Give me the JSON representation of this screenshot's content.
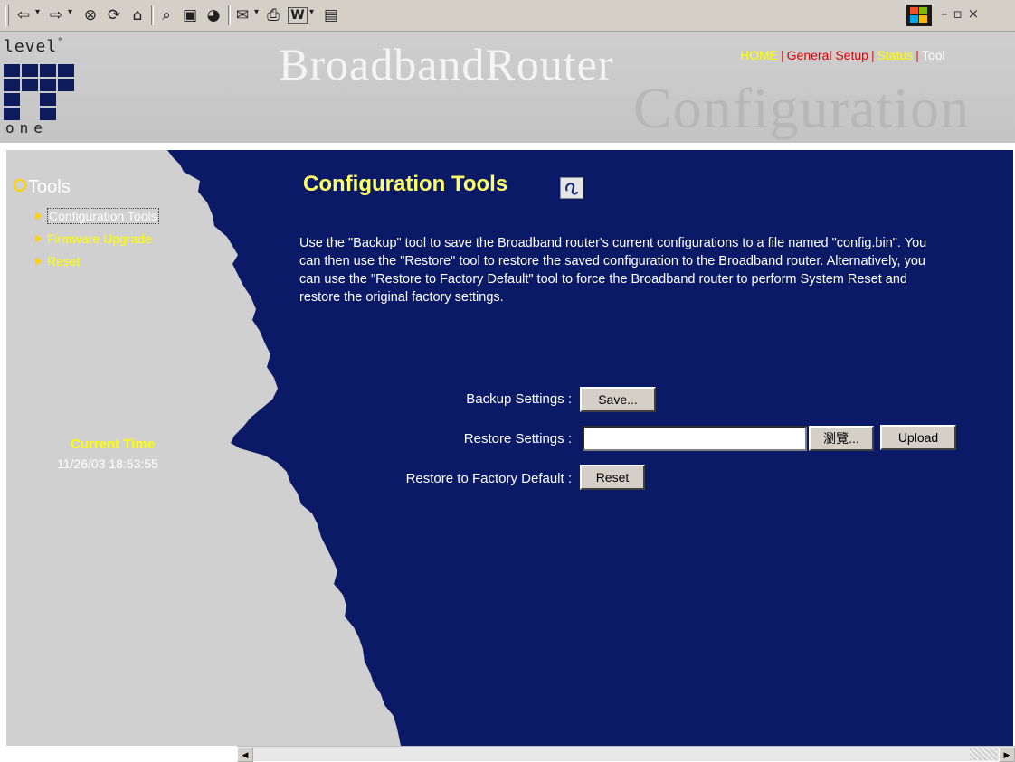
{
  "browser": {
    "toolbar_icons": [
      "back-arrow-icon",
      "forward-arrow-icon",
      "stop-icon",
      "refresh-icon",
      "home-icon",
      "search-icon",
      "favorites-icon",
      "history-icon",
      "mail-icon",
      "print-icon",
      "edit-word-icon",
      "discuss-icon"
    ],
    "back_glyph": "⇦",
    "forward_glyph": "⇨",
    "stop_glyph": "⊗",
    "refresh_glyph": "⟳",
    "home_glyph": "⌂",
    "search_glyph": "⌕",
    "favorites_glyph": "▣",
    "history_glyph": "◕",
    "mail_glyph": "✉",
    "print_glyph": "⎙",
    "edit_glyph": "W",
    "discuss_glyph": "▤",
    "dropdown_glyph": "▾",
    "window_controls": "–▫×"
  },
  "header": {
    "logo_top": "level",
    "logo_bottom": "one",
    "brand": "BroadbandRouter",
    "subtitle": "Configuration",
    "nav": {
      "home": "HOME",
      "general_setup": "General Setup",
      "status": "Status",
      "tool": "Tool"
    }
  },
  "sidebar": {
    "section_title": "Tools",
    "items": [
      {
        "label": "Configuration Tools",
        "active": true
      },
      {
        "label": "Firmware Upgrade",
        "active": false
      },
      {
        "label": "Reset",
        "active": false
      }
    ],
    "time_label": "Current Time",
    "time_value": "11/26/03 18:53:55"
  },
  "main": {
    "title": "Configuration Tools",
    "description": "Use the \"Backup\" tool to save the Broadband router's current configurations to a file named \"config.bin\". You can then use the \"Restore\" tool to restore the saved configuration to the Broadband router. Alternatively, you can use the \"Restore to Factory Default\" tool to force the Broadband router to perform System Reset and restore the original factory settings.",
    "backup_label": "Backup Settings :",
    "backup_button": "Save...",
    "restore_label": "Restore Settings :",
    "restore_value": "",
    "browse_button": "瀏覽...",
    "upload_button": "Upload",
    "factory_label": "Restore to Factory Default :",
    "reset_button": "Reset"
  },
  "colors": {
    "main_bg": "#0a1a66",
    "sidebar_bg": "#d0d0d0",
    "title_yellow": "#ffff66",
    "nav_red": "#e00000",
    "nav_yellow": "#ffff00"
  }
}
